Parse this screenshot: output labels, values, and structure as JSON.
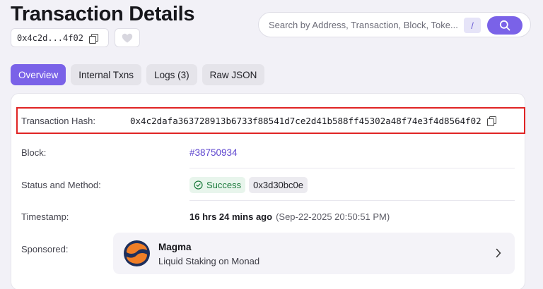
{
  "header": {
    "title": "Transaction Details",
    "short_address": "0x4c2d...4f02"
  },
  "search": {
    "placeholder": "Search by Address, Transaction, Block, Toke...",
    "shortcut": "/"
  },
  "tabs": [
    {
      "label": "Overview",
      "active": true
    },
    {
      "label": "Internal Txns",
      "active": false
    },
    {
      "label": "Logs (3)",
      "active": false
    },
    {
      "label": "Raw JSON",
      "active": false
    }
  ],
  "details": {
    "hash_label": "Transaction Hash:",
    "hash_value": "0x4c2dafa363728913b6733f88541d7ce2d41b588ff45302a48f74e3f4d8564f02",
    "block_label": "Block:",
    "block_value": "#38750934",
    "status_label": "Status and Method:",
    "status_value": "Success",
    "method_value": "0x3d30bc0e",
    "timestamp_label": "Timestamp:",
    "timestamp_relative": "16 hrs 24 mins ago",
    "timestamp_absolute": "(Sep-22-2025 20:50:51 PM)",
    "sponsored_label": "Sponsored:"
  },
  "sponsor": {
    "name": "Magma",
    "tagline": "Liquid Staking on Monad"
  },
  "colors": {
    "accent": "#7a62e8",
    "link": "#5e46cf",
    "success": "#1b7a3c",
    "highlight": "#e02424"
  }
}
